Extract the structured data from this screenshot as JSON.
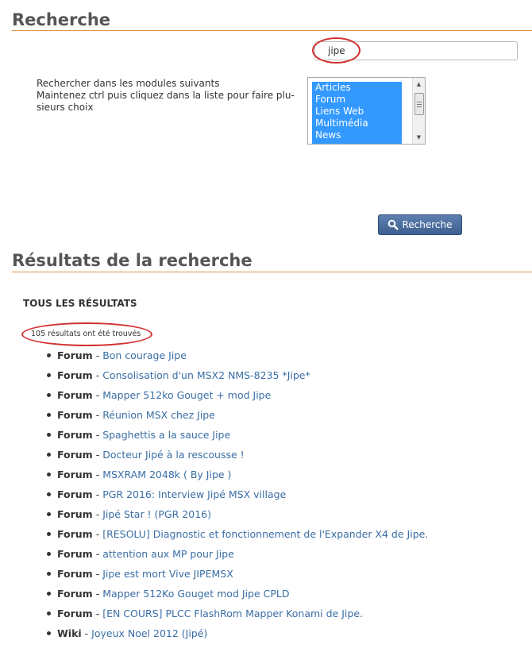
{
  "search_section": {
    "title": "Recherche",
    "query": "jipe",
    "instructions": [
      "Rechercher dans les modules suivants",
      "Maintenez ctrl puis cliquez dans la liste pour faire plu-",
      "sieurs choix"
    ],
    "modules": [
      "Articles",
      "Forum",
      "Liens Web",
      "Multimédia",
      "News"
    ],
    "button_label": "Recherche"
  },
  "results_section": {
    "title": "Résultats de la recherche",
    "subheading": "TOUS LES RÉSULTATS",
    "count_text": "105 résultats ont été trouvés",
    "items": [
      {
        "module": "Forum",
        "title": "Bon courage Jipe"
      },
      {
        "module": "Forum",
        "title": "Consolisation d'un MSX2 NMS-8235 *Jipe*"
      },
      {
        "module": "Forum",
        "title": "Mapper 512ko Gouget + mod Jipe"
      },
      {
        "module": "Forum",
        "title": "Réunion MSX chez Jipe"
      },
      {
        "module": "Forum",
        "title": "Spaghettis a la sauce Jipe"
      },
      {
        "module": "Forum",
        "title": "Docteur Jipé à la rescousse !"
      },
      {
        "module": "Forum",
        "title": "MSXRAM 2048k ( By Jipe )"
      },
      {
        "module": "Forum",
        "title": "PGR 2016: Interview Jipé MSX village"
      },
      {
        "module": "Forum",
        "title": "Jipé Star ! (PGR 2016)"
      },
      {
        "module": "Forum",
        "title": "[RESOLU] Diagnostic et fonctionnement de l'Expander X4 de Jipe."
      },
      {
        "module": "Forum",
        "title": "attention aux MP pour Jipe"
      },
      {
        "module": "Forum",
        "title": "Jipe est mort Vive JIPEMSX"
      },
      {
        "module": "Forum",
        "title": "Mapper 512Ko Gouget mod Jipe CPLD"
      },
      {
        "module": "Forum",
        "title": "[EN COURS] PLCC FlashRom Mapper Konami de Jipe."
      },
      {
        "module": "Wiki",
        "title": "Joyeux Noel 2012 (Jipé)"
      }
    ]
  },
  "colors": {
    "accent_rule": "#e3914b",
    "link": "#3a6ea5",
    "annotation": "#d32f2f",
    "selection": "#3399ff"
  }
}
